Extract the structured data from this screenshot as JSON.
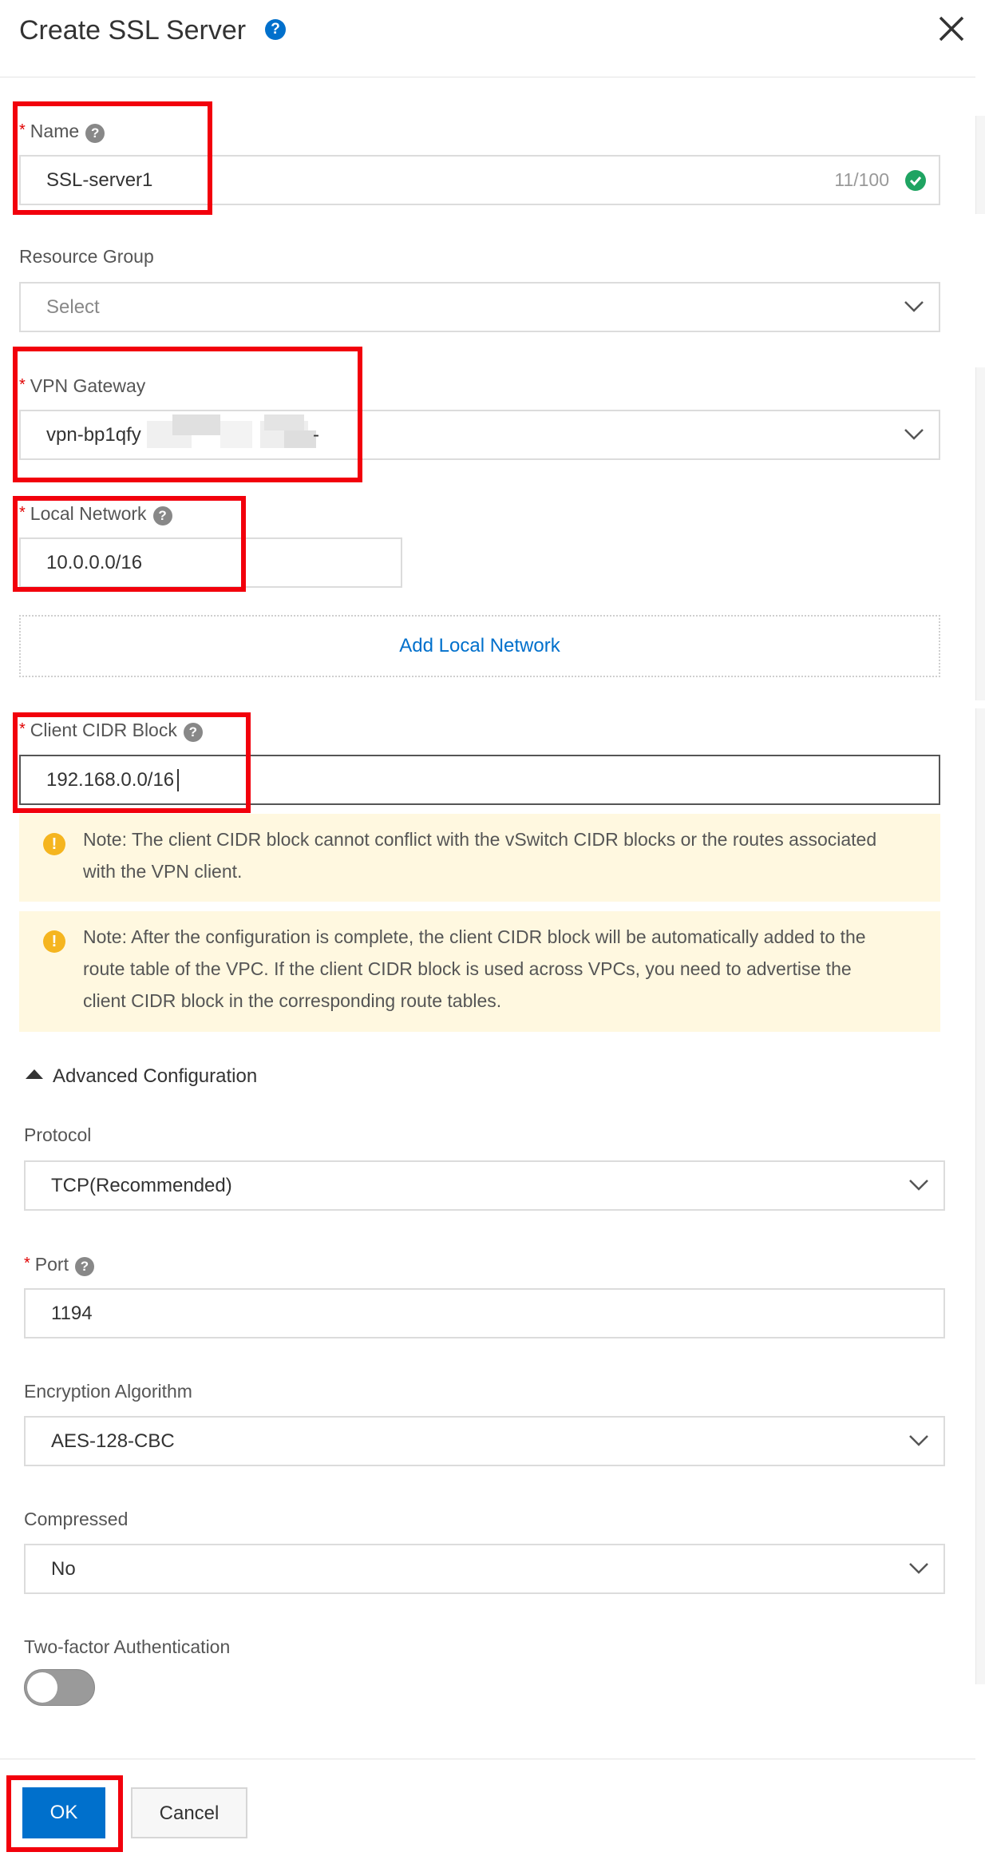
{
  "dialog": {
    "title": "Create SSL Server",
    "close_icon": "close-icon",
    "help_icon": "help-icon"
  },
  "form": {
    "name": {
      "label": "Name",
      "value": "SSL-server1",
      "counter": "11/100"
    },
    "resource_group": {
      "label": "Resource Group",
      "placeholder": "Select"
    },
    "vpn_gateway": {
      "label": "VPN Gateway",
      "value": "vpn-bp1qfy",
      "value_tail": "-"
    },
    "local_network": {
      "label": "Local Network",
      "value": "10.0.0.0/16",
      "add_label": "Add Local Network"
    },
    "client_cidr": {
      "label": "Client CIDR Block",
      "value": "192.168.0.0/16"
    },
    "notes": [
      "Note: The client CIDR block cannot conflict with the vSwitch CIDR blocks or the routes associated with the VPN client.",
      "Note: After the configuration is complete, the client CIDR block will be automatically added to the route table of the VPC. If the client CIDR block is used across VPCs, you need to advertise the client CIDR block in the corresponding route tables."
    ],
    "advanced": {
      "label": "Advanced Configuration"
    },
    "protocol": {
      "label": "Protocol",
      "value": "TCP(Recommended)"
    },
    "port": {
      "label": "Port",
      "value": "1194"
    },
    "encryption": {
      "label": "Encryption Algorithm",
      "value": "AES-128-CBC"
    },
    "compressed": {
      "label": "Compressed",
      "value": "No"
    },
    "two_factor": {
      "label": "Two-factor Authentication",
      "enabled": false
    }
  },
  "footer": {
    "ok_label": "OK",
    "cancel_label": "Cancel"
  },
  "colors": {
    "primary": "#0070cc",
    "highlight": "#f2000c",
    "required": "#e00000",
    "note_bg": "#fff8e0",
    "warn": "#f5b51f",
    "success": "#1fa462"
  },
  "marks": {
    "required": "*",
    "help": "?",
    "warning": "!"
  }
}
